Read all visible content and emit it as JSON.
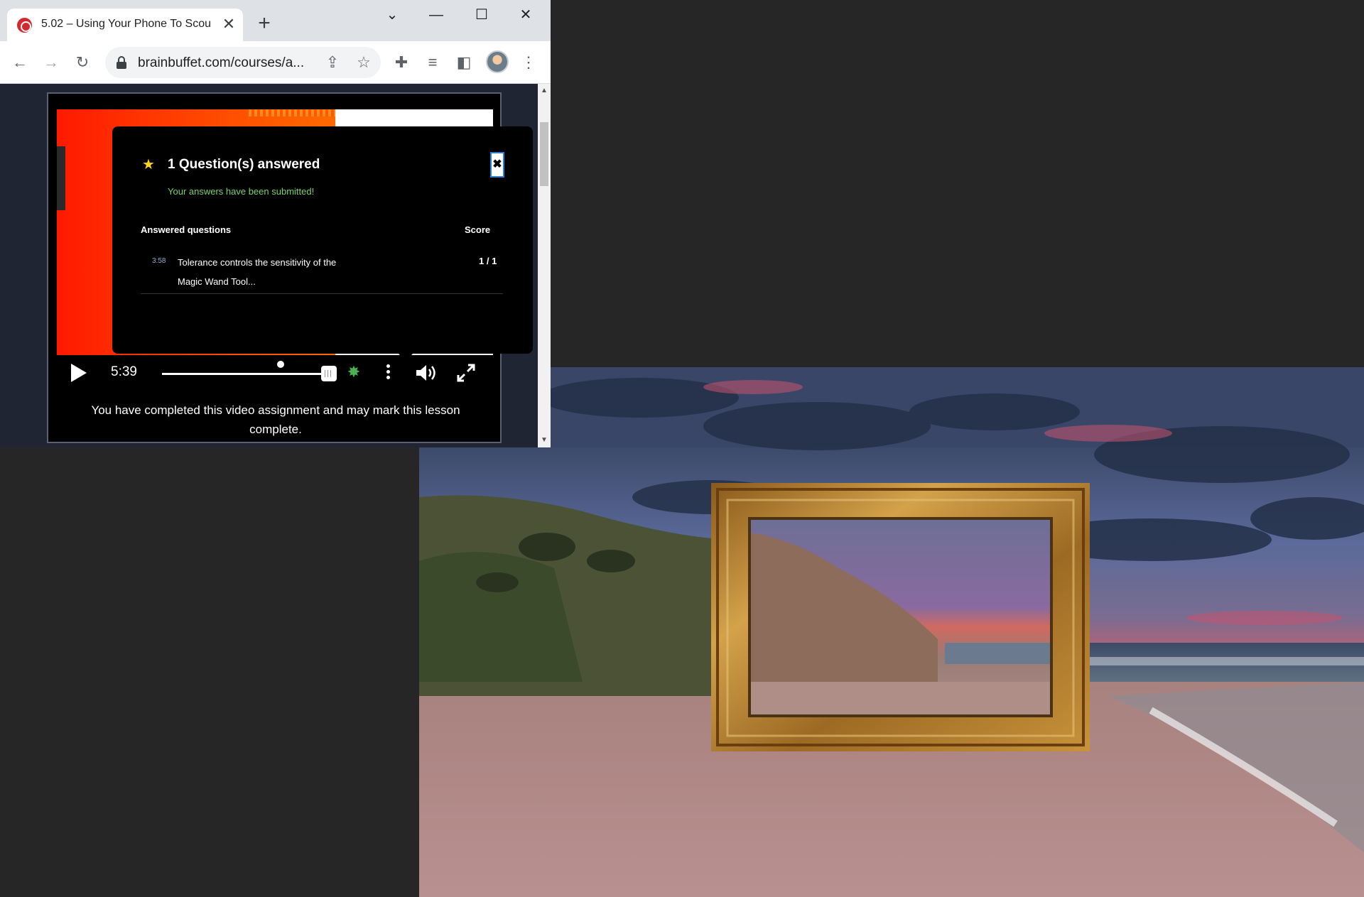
{
  "browser": {
    "tab_title": "5.02 – Using Your Phone To Scou",
    "url": "brainbuffet.com/courses/a...",
    "icons": [
      "favicon-icon",
      "close-icon",
      "plus-icon",
      "chevron-down-icon",
      "minimize-icon",
      "maximize-icon",
      "close-window-icon",
      "back-icon",
      "forward-icon",
      "reload-icon",
      "lock-icon",
      "share-icon",
      "star-icon",
      "extensions-icon",
      "media-icon",
      "side-panel-icon",
      "avatar",
      "menu-icon"
    ]
  },
  "quiz": {
    "title": "1 Question(s) answered",
    "status": "Your answers have been submitted!",
    "close_label": "✖",
    "col_answered": "Answered questions",
    "col_score": "Score",
    "questions": [
      {
        "time": "3:58",
        "text": "Tolerance controls the sensitivity of the Magic Wand Tool...",
        "score": "1 / 1"
      }
    ]
  },
  "player": {
    "time": "5:39",
    "progress_fraction": 1.0,
    "completion_text": "You have completed this video assignment and may mark this lesson complete."
  },
  "colors": {
    "status_green": "#7ed36a",
    "accent_blue": "#2b7cd3",
    "star_yellow": "#ffd51a",
    "video_red": "#ff1a00"
  }
}
